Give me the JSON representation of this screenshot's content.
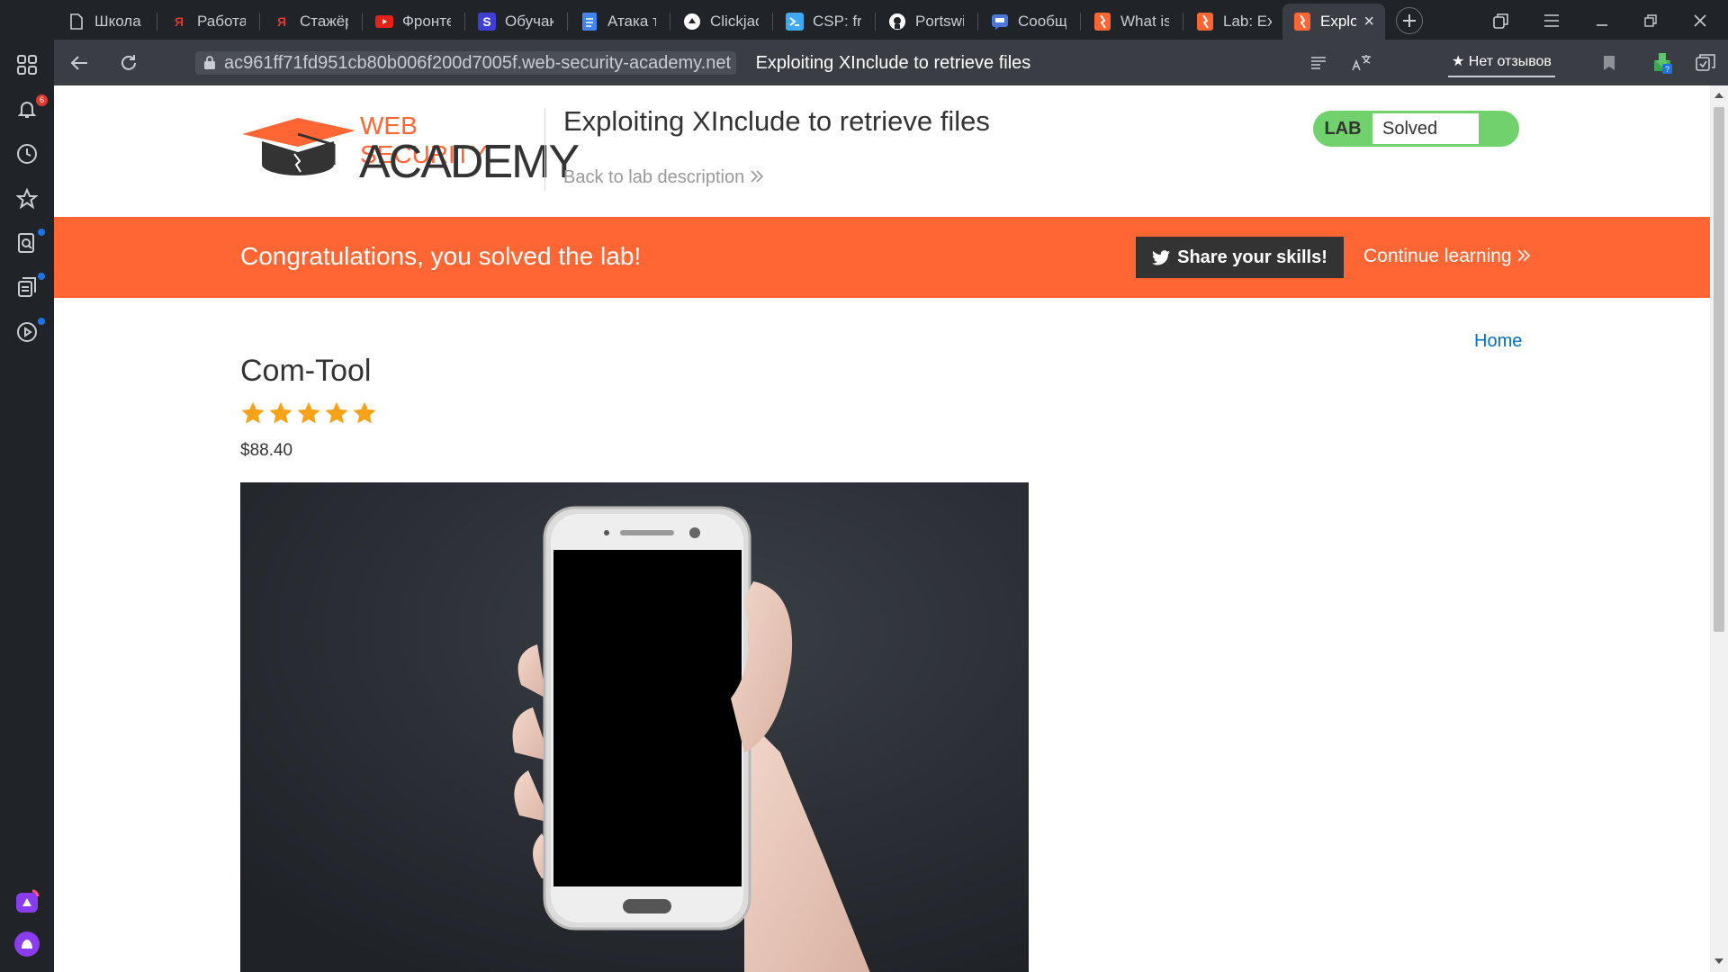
{
  "browser": {
    "tabs": [
      {
        "title": "Школа",
        "icon": "document-icon",
        "active": false
      },
      {
        "title": "Работа",
        "icon": "yandex-icon",
        "active": false
      },
      {
        "title": "Стажёр",
        "icon": "yandex-icon",
        "active": false
      },
      {
        "title": "Фронте",
        "icon": "youtube-icon",
        "active": false
      },
      {
        "title": "Обучак",
        "icon": "stepik-icon",
        "active": false
      },
      {
        "title": "Атака т",
        "icon": "docs-icon",
        "active": false
      },
      {
        "title": "Clickjacl",
        "icon": "clickjack-icon",
        "active": false
      },
      {
        "title": "CSP: fra",
        "icon": "csp-icon",
        "active": false
      },
      {
        "title": "Portswic",
        "icon": "github-icon",
        "active": false
      },
      {
        "title": "Сообщ",
        "icon": "chat-icon",
        "active": false
      },
      {
        "title": "What is",
        "icon": "portswigger-icon",
        "active": false
      },
      {
        "title": "Lab: Exp",
        "icon": "portswigger-icon",
        "active": false
      },
      {
        "title": "Explo",
        "icon": "portswigger-icon",
        "active": true
      }
    ],
    "address": {
      "domain": "ac961ff71fd951cb80b006f200d7005f.web-security-academy.net",
      "page_title": "Exploiting XInclude to retrieve files"
    },
    "review_label": "Нет отзывов",
    "notification_count": "6",
    "colors": {
      "chrome": "#202327",
      "toolbar": "#3a3e44",
      "accent_dot": "#1a73e8",
      "badge": "#e03a2f"
    }
  },
  "header": {
    "logo_line1": "WEB SECURITY",
    "logo_line2": "ACADEMY",
    "lab_title": "Exploiting XInclude to retrieve files",
    "back_link": "Back to lab description",
    "status_tag": "LAB",
    "status_value": "Solved",
    "colors": {
      "brand_orange": "#ff6633",
      "solved_green": "#70d16d"
    }
  },
  "banner": {
    "message": "Congratulations, you solved the lab!",
    "share_label": "Share your skills!",
    "continue_label": "Continue learning"
  },
  "nav": {
    "home_label": "Home"
  },
  "product": {
    "name": "Com-Tool",
    "rating": 5,
    "rating_max": 5,
    "price": "$88.40",
    "image_icon": "smartphone-in-hand-photo"
  }
}
